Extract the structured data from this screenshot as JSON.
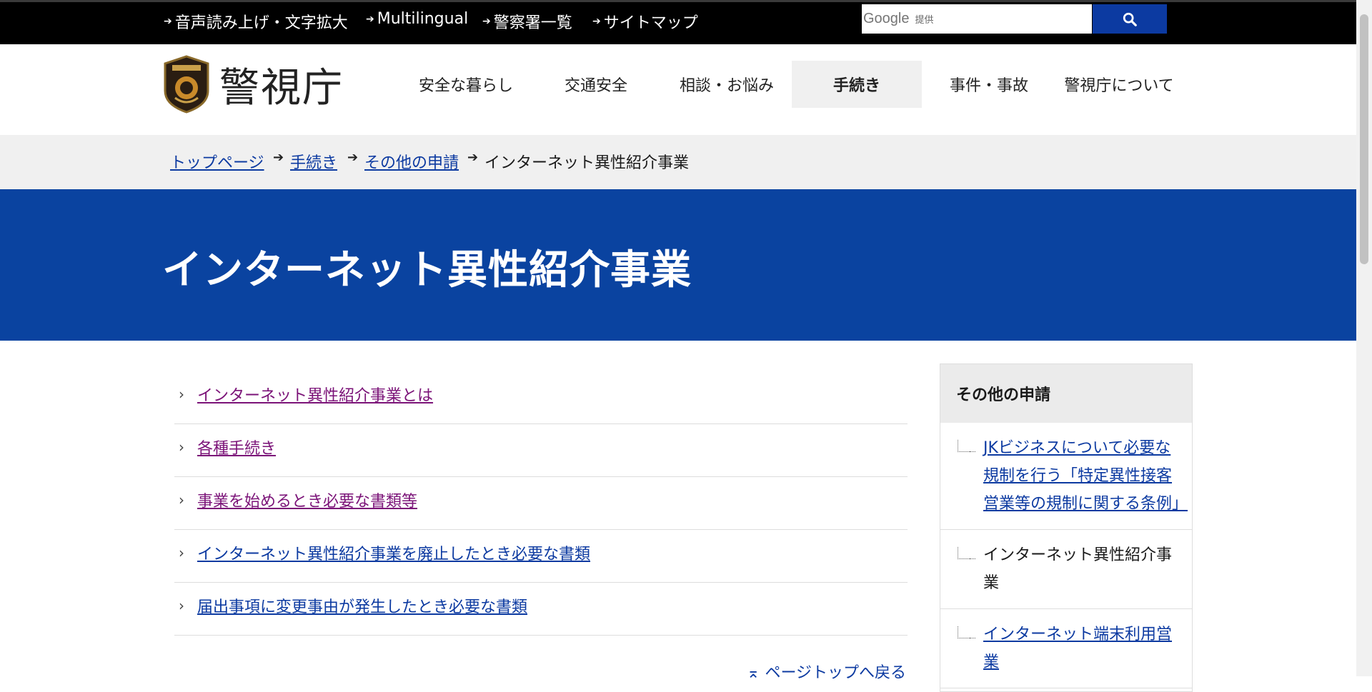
{
  "utility_nav": [
    {
      "label": "音声読み上げ・文字拡大"
    },
    {
      "label": "Multilingual"
    },
    {
      "label": "警察署一覧"
    },
    {
      "label": "サイトマップ"
    }
  ],
  "search": {
    "brand": "Google",
    "brand_suffix": "提供",
    "value": ""
  },
  "site": {
    "name": "警視庁"
  },
  "global_nav": [
    {
      "label": "安全な暮らし"
    },
    {
      "label": "交通安全"
    },
    {
      "label": "相談・お悩み"
    },
    {
      "label": "手続き",
      "active": true
    },
    {
      "label": "事件・事故"
    },
    {
      "label": "警視庁について"
    }
  ],
  "breadcrumb": {
    "items": [
      "トップページ",
      "手続き",
      "その他の申請"
    ],
    "current": "インターネット異性紹介事業"
  },
  "page": {
    "title": "インターネット異性紹介事業"
  },
  "content_links": [
    {
      "label": "インターネット異性紹介事業とは",
      "visited": true
    },
    {
      "label": "各種手続き",
      "visited": true
    },
    {
      "label": "事業を始めるとき必要な書類等",
      "visited": true
    },
    {
      "label": "インターネット異性紹介事業を廃止したとき必要な書類",
      "visited": false
    },
    {
      "label": "届出事項に変更事由が発生したとき必要な書類",
      "visited": false
    }
  ],
  "page_top": {
    "label": "ページトップへ戻る"
  },
  "side_nav": {
    "heading": "その他の申請",
    "items": [
      {
        "label": "JKビジネスについて必要な規制を行う「特定異性接客営業等の規制に関する条例」",
        "link": true
      },
      {
        "label": "インターネット異性紹介事業",
        "link": false
      },
      {
        "label": "インターネット端末利用営業",
        "link": true
      }
    ]
  },
  "colors": {
    "brand_blue": "#0a43a0",
    "link_blue": "#0c3aa1",
    "visited_purple": "#7b1378"
  }
}
